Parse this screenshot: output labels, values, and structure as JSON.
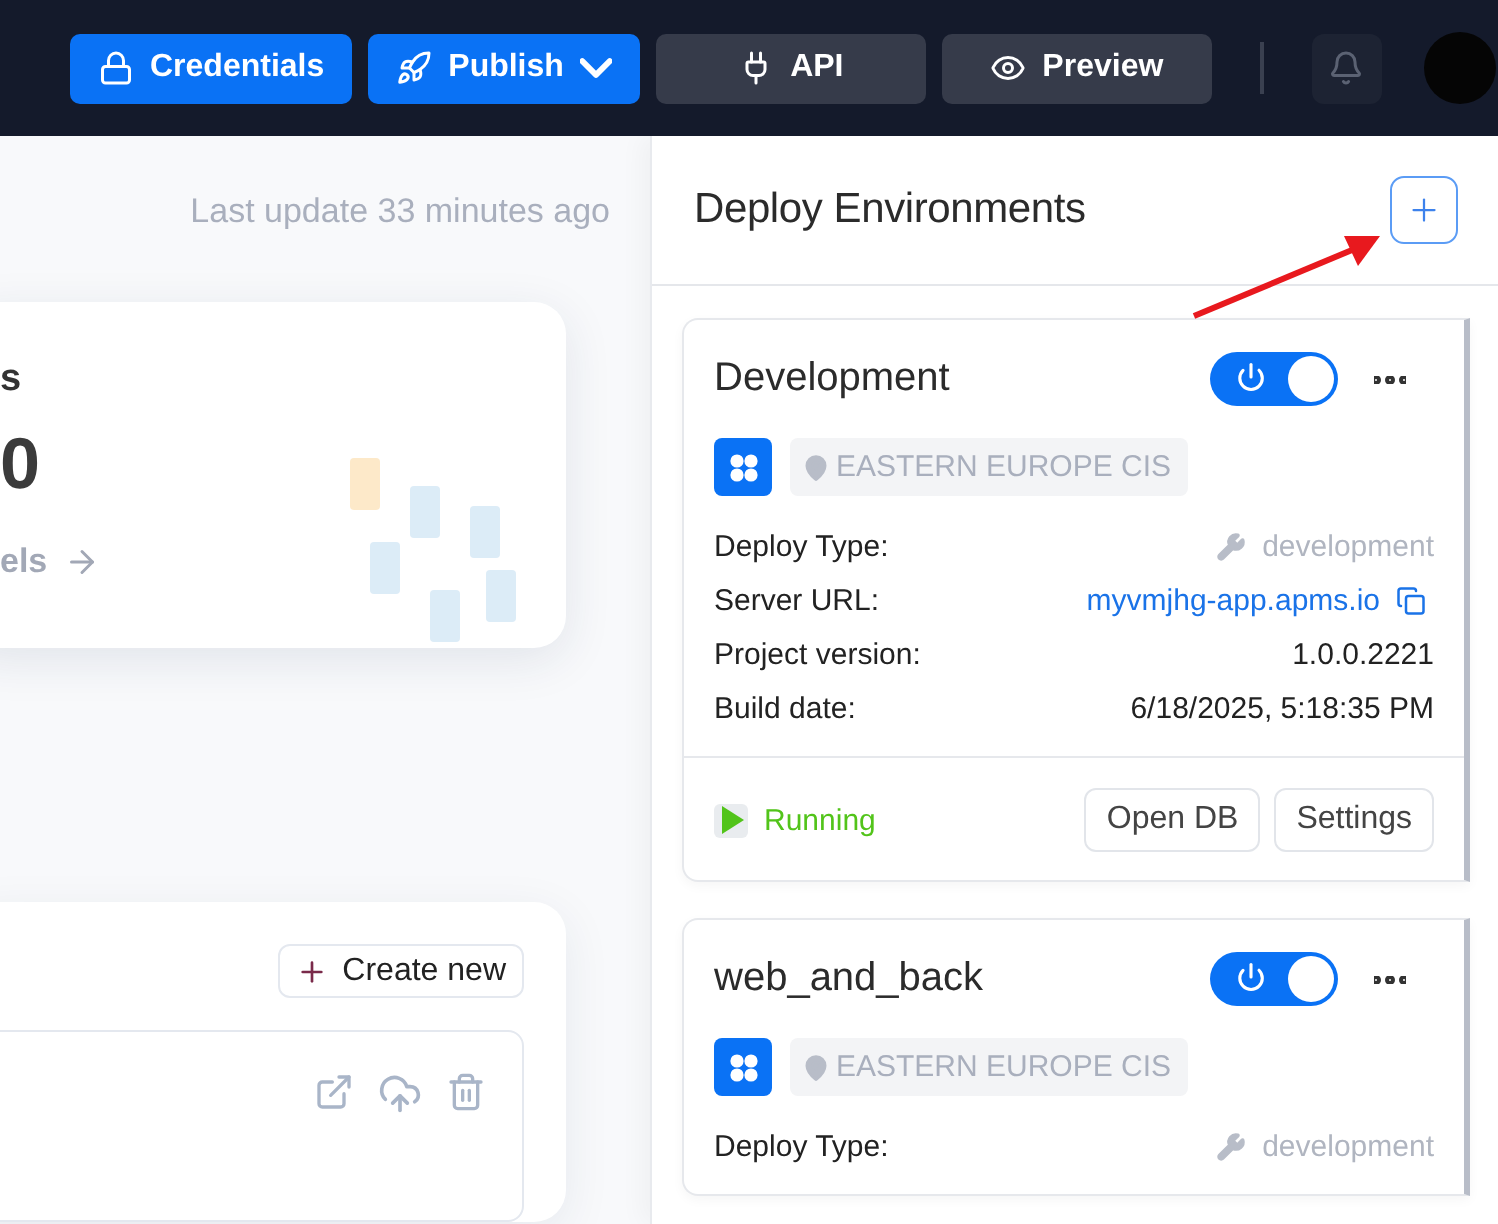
{
  "topbar": {
    "buttons": [
      {
        "label": "Credentials",
        "kind": "primary",
        "dropdown": false
      },
      {
        "label": "Publish",
        "kind": "primary",
        "dropdown": true
      },
      {
        "label": "API",
        "kind": "secondary",
        "dropdown": false
      },
      {
        "label": "Preview",
        "kind": "secondary",
        "dropdown": false
      }
    ]
  },
  "main": {
    "last_update": "Last update 33 minutes ago",
    "stats_card": {
      "title": "s",
      "value": "0",
      "link": "els"
    },
    "list_card": {
      "create_button": "Create new"
    }
  },
  "deploy_panel": {
    "title": "Deploy Environments",
    "environments": [
      {
        "name": "Development",
        "on": true,
        "region": "EASTERN EUROPE CIS",
        "details": [
          {
            "label": "Deploy Type:",
            "value": "development",
            "kind": "type"
          },
          {
            "label": "Server URL:",
            "value": "myvmjhg-app.apms.io",
            "kind": "link"
          },
          {
            "label": "Project version:",
            "value": "1.0.0.2221",
            "kind": "plain"
          },
          {
            "label": "Build date:",
            "value": "6/18/2025, 5:18:35 PM",
            "kind": "plain"
          }
        ],
        "status": "Running",
        "actions": [
          "Open DB",
          "Settings"
        ]
      },
      {
        "name": "web_and_back",
        "on": true,
        "region": "EASTERN EUROPE CIS",
        "details": [
          {
            "label": "Deploy Type:",
            "value": "development",
            "kind": "type"
          }
        ]
      }
    ]
  }
}
